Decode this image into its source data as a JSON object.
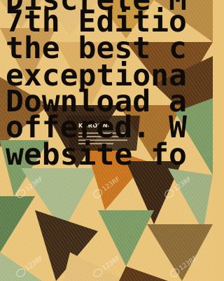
{
  "overlay_lines": [
    "Discrete M",
    "7th Editio",
    "the best c",
    "exceptiona",
    "Download a",
    "offered. W",
    "website fo"
  ],
  "poster": {
    "heading": "KGROUND"
  },
  "watermark": {
    "brand": "123RF"
  },
  "colors": {
    "background": "#e9c479",
    "dark_brown": "#3a2412",
    "mid_brown": "#7a4a1c",
    "orange": "#c9731c",
    "green": "#7c9a64",
    "light_green": "#a9b98a",
    "sand": "#e9c479",
    "text": "#0f0c08"
  }
}
